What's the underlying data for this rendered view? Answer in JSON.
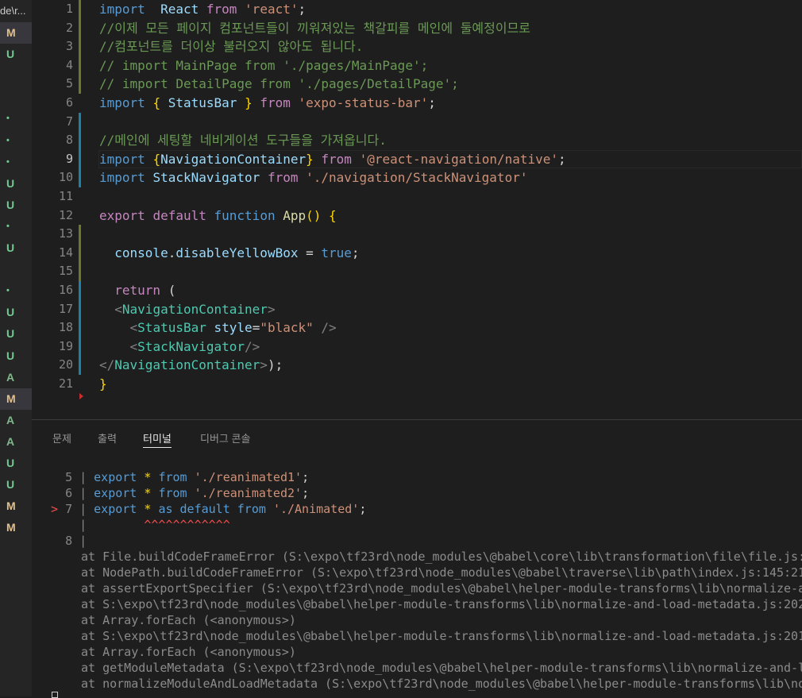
{
  "explorer": {
    "path_fragment": "de\\r...",
    "markers": [
      "M",
      "U",
      "",
      "",
      "•",
      "•",
      "•",
      "U",
      "U",
      "•",
      "U",
      "",
      "•",
      "U",
      "U",
      "U",
      "A",
      "M",
      "A",
      "A",
      "U",
      "U",
      "M",
      "M"
    ]
  },
  "editor": {
    "active_line": 9,
    "lines": [
      {
        "n": "1",
        "bar": "mod"
      },
      {
        "n": "2",
        "bar": "mod"
      },
      {
        "n": "3",
        "bar": "mod"
      },
      {
        "n": "4",
        "bar": "mod"
      },
      {
        "n": "5",
        "bar": "mod"
      },
      {
        "n": "6",
        "bar": ""
      },
      {
        "n": "7",
        "bar": "add"
      },
      {
        "n": "8",
        "bar": "add"
      },
      {
        "n": "9",
        "bar": "add"
      },
      {
        "n": "10",
        "bar": "add"
      },
      {
        "n": "11",
        "bar": ""
      },
      {
        "n": "12",
        "bar": ""
      },
      {
        "n": "13",
        "bar": "mod"
      },
      {
        "n": "14",
        "bar": "mod"
      },
      {
        "n": "15",
        "bar": "mod"
      },
      {
        "n": "16",
        "bar": "add"
      },
      {
        "n": "17",
        "bar": "add"
      },
      {
        "n": "18",
        "bar": "add"
      },
      {
        "n": "19",
        "bar": "add"
      },
      {
        "n": "20",
        "bar": "add"
      },
      {
        "n": "21",
        "bar": ""
      }
    ],
    "code": [
      [
        [
          "kb",
          "import"
        ],
        [
          "",
          "  "
        ],
        [
          "var",
          "React"
        ],
        [
          "",
          " "
        ],
        [
          "kw",
          "from"
        ],
        [
          "",
          " "
        ],
        [
          "str",
          "'react'"
        ],
        [
          "",
          ";"
        ]
      ],
      [
        [
          "cm",
          "//이제 모든 페이지 컴포넌트들이 끼워져있는 책갈피를 메인에 둘예정이므로"
        ]
      ],
      [
        [
          "cm",
          "//컴포넌트를 더이상 불러오지 않아도 됩니다."
        ]
      ],
      [
        [
          "cm",
          "// import MainPage from './pages/MainPage';"
        ]
      ],
      [
        [
          "cm",
          "// import DetailPage from './pages/DetailPage';"
        ]
      ],
      [
        [
          "kb",
          "import"
        ],
        [
          "",
          " "
        ],
        [
          "br",
          "{"
        ],
        [
          "",
          " "
        ],
        [
          "var",
          "StatusBar"
        ],
        [
          "",
          " "
        ],
        [
          "br",
          "}"
        ],
        [
          "",
          " "
        ],
        [
          "kw",
          "from"
        ],
        [
          "",
          " "
        ],
        [
          "str",
          "'expo-status-bar'"
        ],
        [
          "",
          ";"
        ]
      ],
      [
        [
          "",
          ""
        ]
      ],
      [
        [
          "cm",
          "//메인에 세팅할 네비게이션 도구들을 가져옵니다."
        ]
      ],
      [
        [
          "kb",
          "import"
        ],
        [
          "",
          " "
        ],
        [
          "br",
          "{"
        ],
        [
          "var",
          "NavigationContainer"
        ],
        [
          "br",
          "}"
        ],
        [
          "",
          " "
        ],
        [
          "kw",
          "from"
        ],
        [
          "",
          " "
        ],
        [
          "str",
          "'@react-navigation/native'"
        ],
        [
          "",
          ";"
        ]
      ],
      [
        [
          "kb",
          "import"
        ],
        [
          "",
          " "
        ],
        [
          "var",
          "StackNavigator"
        ],
        [
          "",
          " "
        ],
        [
          "kw",
          "from"
        ],
        [
          "",
          " "
        ],
        [
          "str",
          "'./navigation/StackNavigator'"
        ]
      ],
      [
        [
          "",
          ""
        ]
      ],
      [
        [
          "kw",
          "export"
        ],
        [
          "",
          " "
        ],
        [
          "kw",
          "default"
        ],
        [
          "",
          " "
        ],
        [
          "kb",
          "function"
        ],
        [
          "",
          " "
        ],
        [
          "fn",
          "App"
        ],
        [
          "br",
          "()"
        ],
        [
          "",
          " "
        ],
        [
          "br",
          "{"
        ]
      ],
      [
        [
          "",
          ""
        ]
      ],
      [
        [
          "",
          "  "
        ],
        [
          "var",
          "console"
        ],
        [
          "",
          "."
        ],
        [
          "var",
          "disableYellowBox"
        ],
        [
          "",
          " = "
        ],
        [
          "kb",
          "true"
        ],
        [
          "",
          ";"
        ]
      ],
      [
        [
          "",
          ""
        ]
      ],
      [
        [
          "",
          "  "
        ],
        [
          "kw",
          "return"
        ],
        [
          "",
          " ("
        ]
      ],
      [
        [
          "",
          "  "
        ],
        [
          "pu",
          "<"
        ],
        [
          "tag",
          "NavigationContainer"
        ],
        [
          "pu",
          ">"
        ]
      ],
      [
        [
          "",
          "    "
        ],
        [
          "pu",
          "<"
        ],
        [
          "tag",
          "StatusBar"
        ],
        [
          "",
          " "
        ],
        [
          "var",
          "style"
        ],
        [
          "",
          "="
        ],
        [
          "str",
          "\"black\""
        ],
        [
          "",
          " "
        ],
        [
          "pu",
          "/>"
        ]
      ],
      [
        [
          "",
          "    "
        ],
        [
          "pu",
          "<"
        ],
        [
          "tag",
          "StackNavigator"
        ],
        [
          "pu",
          "/>"
        ]
      ],
      [
        [
          "",
          "",
          " "
        ],
        [
          "pu",
          "</"
        ],
        [
          "tag",
          "NavigationContainer"
        ],
        [
          "pu",
          ">"
        ],
        [
          "",
          ");"
        ]
      ],
      [
        [
          "br",
          "}"
        ]
      ]
    ]
  },
  "panel": {
    "tabs": [
      "문제",
      "출력",
      "터미널",
      "디버그 콘솔"
    ],
    "active_tab": "터미널"
  },
  "terminal": {
    "code_frame": [
      {
        "marker": " ",
        "num": "5",
        "code": [
          [
            "kb",
            "export"
          ],
          [
            "",
            " "
          ],
          [
            "br",
            "*"
          ],
          [
            "",
            " "
          ],
          [
            "kb",
            "from"
          ],
          [
            "",
            " "
          ],
          [
            "str",
            "'./reanimated1'"
          ],
          [
            "",
            ";"
          ]
        ]
      },
      {
        "marker": " ",
        "num": "6",
        "code": [
          [
            "kb",
            "export"
          ],
          [
            "",
            " "
          ],
          [
            "br",
            "*"
          ],
          [
            "",
            " "
          ],
          [
            "kb",
            "from"
          ],
          [
            "",
            " "
          ],
          [
            "str",
            "'./reanimated2'"
          ],
          [
            "",
            ";"
          ]
        ]
      },
      {
        "marker": ">",
        "num": "7",
        "code": [
          [
            "kb",
            "export"
          ],
          [
            "",
            " "
          ],
          [
            "br",
            "*"
          ],
          [
            "",
            " "
          ],
          [
            "kb",
            "as"
          ],
          [
            "",
            " "
          ],
          [
            "kb",
            "default"
          ],
          [
            "",
            " "
          ],
          [
            "kb",
            "from"
          ],
          [
            "",
            " "
          ],
          [
            "str",
            "'./Animated'"
          ],
          [
            "",
            ";"
          ]
        ]
      },
      {
        "marker": " ",
        "num": "",
        "code": [
          [
            "tcaret",
            "       ^^^^^^^^^^^^"
          ]
        ]
      },
      {
        "marker": " ",
        "num": "8",
        "code": []
      }
    ],
    "stack": [
      "at File.buildCodeFrameError (S:\\expo\\tf23rd\\node_modules\\@babel\\core\\lib\\transformation\\file\\file.js:",
      "at NodePath.buildCodeFrameError (S:\\expo\\tf23rd\\node_modules\\@babel\\traverse\\lib\\path\\index.js:145:21",
      "at assertExportSpecifier (S:\\expo\\tf23rd\\node_modules\\@babel\\helper-module-transforms\\lib\\normalize-a",
      "at S:\\expo\\tf23rd\\node_modules\\@babel\\helper-module-transforms\\lib\\normalize-and-load-metadata.js:202",
      "at Array.forEach (<anonymous>)",
      "at S:\\expo\\tf23rd\\node_modules\\@babel\\helper-module-transforms\\lib\\normalize-and-load-metadata.js:201",
      "at Array.forEach (<anonymous>)",
      "at getModuleMetadata (S:\\expo\\tf23rd\\node_modules\\@babel\\helper-module-transforms\\lib\\normalize-and-l",
      "at normalizeModuleAndLoadMetadata (S:\\expo\\tf23rd\\node_modules\\@babel\\helper-module-transforms\\lib\\no"
    ]
  }
}
